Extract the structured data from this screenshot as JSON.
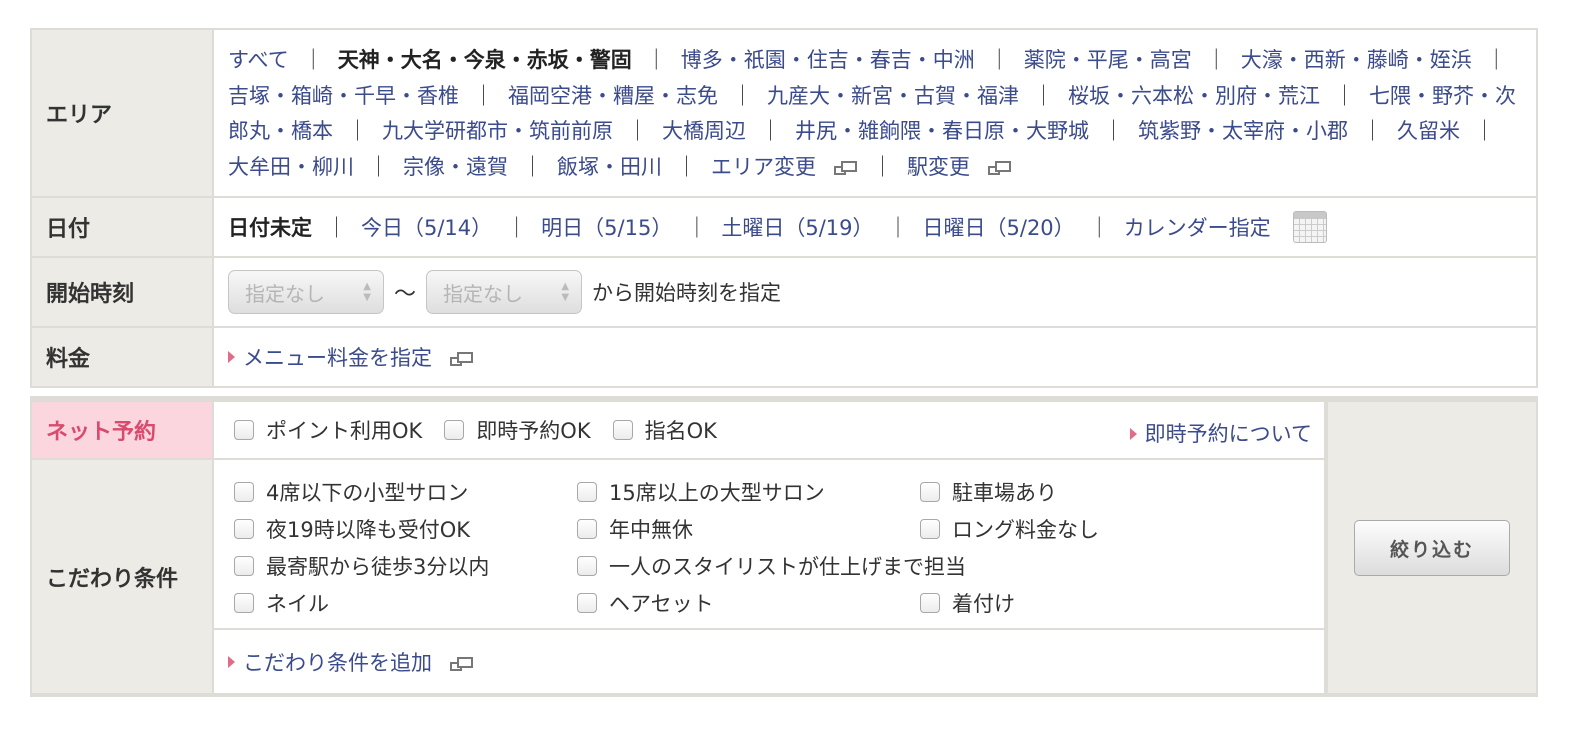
{
  "area": {
    "label": "エリア",
    "all": "すべて",
    "current": "天神・大名・今泉・赤坂・警固",
    "items": [
      "博多・祇園・住吉・春吉・中洲",
      "薬院・平尾・高宮",
      "大濠・西新・藤崎・姪浜",
      "吉塚・箱崎・千早・香椎",
      "福岡空港・糟屋・志免",
      "九産大・新宮・古賀・福津",
      "桜坂・六本松・別府・荒江",
      "七隈・野芥・次郎丸・橋本",
      "九大学研都市・筑前前原",
      "大橋周辺",
      "井尻・雑餉隈・春日原・大野城",
      "筑紫野・太宰府・小郡",
      "久留米",
      "大牟田・柳川",
      "宗像・遠賀",
      "飯塚・田川"
    ],
    "change_area": "エリア変更",
    "change_station": "駅変更",
    "separator": "｜"
  },
  "date": {
    "label": "日付",
    "unset": "日付未定",
    "today": "今日（5/14）",
    "tomorrow": "明日（5/15）",
    "saturday": "土曜日（5/19）",
    "sunday": "日曜日（5/20）",
    "calendar": "カレンダー指定"
  },
  "start_time": {
    "label": "開始時刻",
    "from_placeholder": "指定なし",
    "to_placeholder": "指定なし",
    "tilde": "〜",
    "suffix": "から開始時刻を指定"
  },
  "price": {
    "label": "料金",
    "link": "メニュー料金を指定"
  },
  "net_reservation": {
    "label": "ネット予約",
    "options": [
      "ポイント利用OK",
      "即時予約OK",
      "指名OK"
    ],
    "about_link": "即時予約について"
  },
  "kodawari": {
    "label": "こだわり条件",
    "options": [
      "4席以下の小型サロン",
      "15席以上の大型サロン",
      "駐車場あり",
      "夜19時以降も受付OK",
      "年中無休",
      "ロング料金なし",
      "最寄駅から徒歩3分以内",
      "一人のスタイリストが仕上げまで担当",
      "ネイル",
      "ヘアセット",
      "着付け"
    ],
    "add_link": "こだわり条件を追加"
  },
  "filter_button": "絞り込む",
  "icons": {
    "external": "external-window-icon",
    "calendar": "calendar-icon",
    "link_marker": "triangle-right-icon"
  },
  "colors": {
    "link": "#3b4b8c",
    "accent_pink": "#d94a6d",
    "header_bg": "#ecebe5",
    "net_header_bg": "#fbd6df"
  }
}
